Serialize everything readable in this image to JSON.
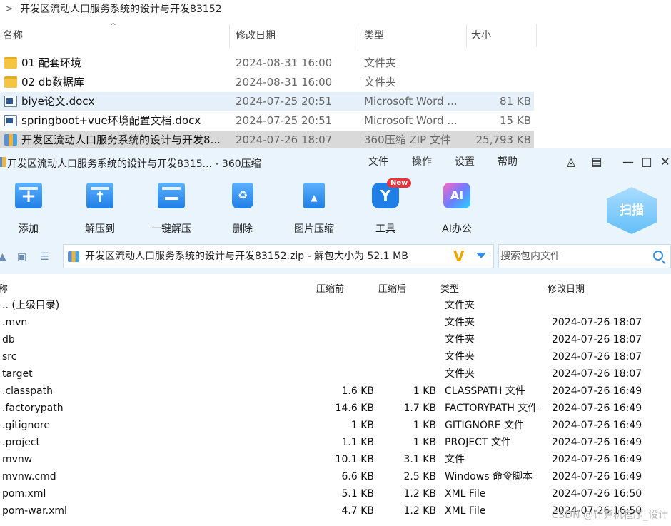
{
  "explorer": {
    "breadcrumb": "开发区流动人口服务系统的设计与开发83152",
    "columns": {
      "name": "名称",
      "date": "修改日期",
      "type": "类型",
      "size": "大小"
    },
    "rows": [
      {
        "name": "01 配套环境",
        "date": "2024-08-31 16:00",
        "type": "文件夹",
        "size": "",
        "icon": "folder-icon"
      },
      {
        "name": "02 db数据库",
        "date": "2024-08-31 16:00",
        "type": "文件夹",
        "size": "",
        "icon": "folder-icon"
      },
      {
        "name": "biye论文.docx",
        "date": "2024-07-25 20:51",
        "type": "Microsoft Word ...",
        "size": "81 KB",
        "icon": "word-doc-icon"
      },
      {
        "name": "springboot+vue环境配置文档.docx",
        "date": "2024-07-25 20:51",
        "type": "Microsoft Word ...",
        "size": "15 KB",
        "icon": "word-doc-icon"
      },
      {
        "name": "开发区流动人口服务系统的设计与开发8...",
        "date": "2024-07-26 18:07",
        "type": "360压缩 ZIP 文件",
        "size": "25,793 KB",
        "icon": "zip-archive-icon"
      }
    ]
  },
  "zipwin": {
    "title": "开发区流动人口服务系统的设计与开发8315... - 360压缩",
    "menu": [
      "文件",
      "操作",
      "设置",
      "帮助"
    ],
    "toolbar": [
      {
        "label": "添加",
        "icon": "add-icon"
      },
      {
        "label": "解压到",
        "icon": "extract-to-icon"
      },
      {
        "label": "一键解压",
        "icon": "one-click-extract-icon"
      },
      {
        "label": "删除",
        "icon": "delete-icon"
      },
      {
        "label": "图片压缩",
        "icon": "image-compress-icon"
      },
      {
        "label": "工具",
        "icon": "tools-icon"
      },
      {
        "label": "AI办公",
        "icon": "ai-office-icon"
      }
    ],
    "new_badge": "New",
    "scan_label": "扫描",
    "address": "开发区流动人口服务系统的设计与开发83152.zip - 解包大小为 52.1 MB",
    "search_placeholder": "搜索包内文件",
    "columns": {
      "name": "称",
      "packed_before": "压缩前",
      "packed_after": "压缩后",
      "type": "类型",
      "modified": "修改日期"
    },
    "files": [
      {
        "name": ".. (上级目录)",
        "before": "",
        "after": "",
        "type": "文件夹",
        "modified": ""
      },
      {
        "name": ".mvn",
        "before": "",
        "after": "",
        "type": "文件夹",
        "modified": "2024-07-26 18:07"
      },
      {
        "name": "db",
        "before": "",
        "after": "",
        "type": "文件夹",
        "modified": "2024-07-26 18:07"
      },
      {
        "name": "src",
        "before": "",
        "after": "",
        "type": "文件夹",
        "modified": "2024-07-26 18:07"
      },
      {
        "name": "target",
        "before": "",
        "after": "",
        "type": "文件夹",
        "modified": "2024-07-26 18:07"
      },
      {
        "name": ".classpath",
        "before": "1.6 KB",
        "after": "1 KB",
        "type": "CLASSPATH 文件",
        "modified": "2024-07-26 16:49"
      },
      {
        "name": ".factorypath",
        "before": "14.6 KB",
        "after": "1.7 KB",
        "type": "FACTORYPATH 文件",
        "modified": "2024-07-26 16:49"
      },
      {
        "name": ".gitignore",
        "before": "1 KB",
        "after": "1 KB",
        "type": "GITIGNORE 文件",
        "modified": "2024-07-26 16:49"
      },
      {
        "name": ".project",
        "before": "1.1 KB",
        "after": "1 KB",
        "type": "PROJECT 文件",
        "modified": "2024-07-26 16:49"
      },
      {
        "name": "mvnw",
        "before": "10.1 KB",
        "after": "3.1 KB",
        "type": "文件",
        "modified": "2024-07-26 16:49"
      },
      {
        "name": "mvnw.cmd",
        "before": "6.6 KB",
        "after": "2.5 KB",
        "type": "Windows 命令脚本",
        "modified": "2024-07-26 16:49"
      },
      {
        "name": "pom.xml",
        "before": "5.1 KB",
        "after": "1.2 KB",
        "type": "XML File",
        "modified": "2024-07-26 16:50"
      },
      {
        "name": "pom-war.xml",
        "before": "4.7 KB",
        "after": "1.2 KB",
        "type": "XML File",
        "modified": "2024-07-26 16:50"
      }
    ]
  },
  "watermark": "CSDN @计算机程序_设计"
}
